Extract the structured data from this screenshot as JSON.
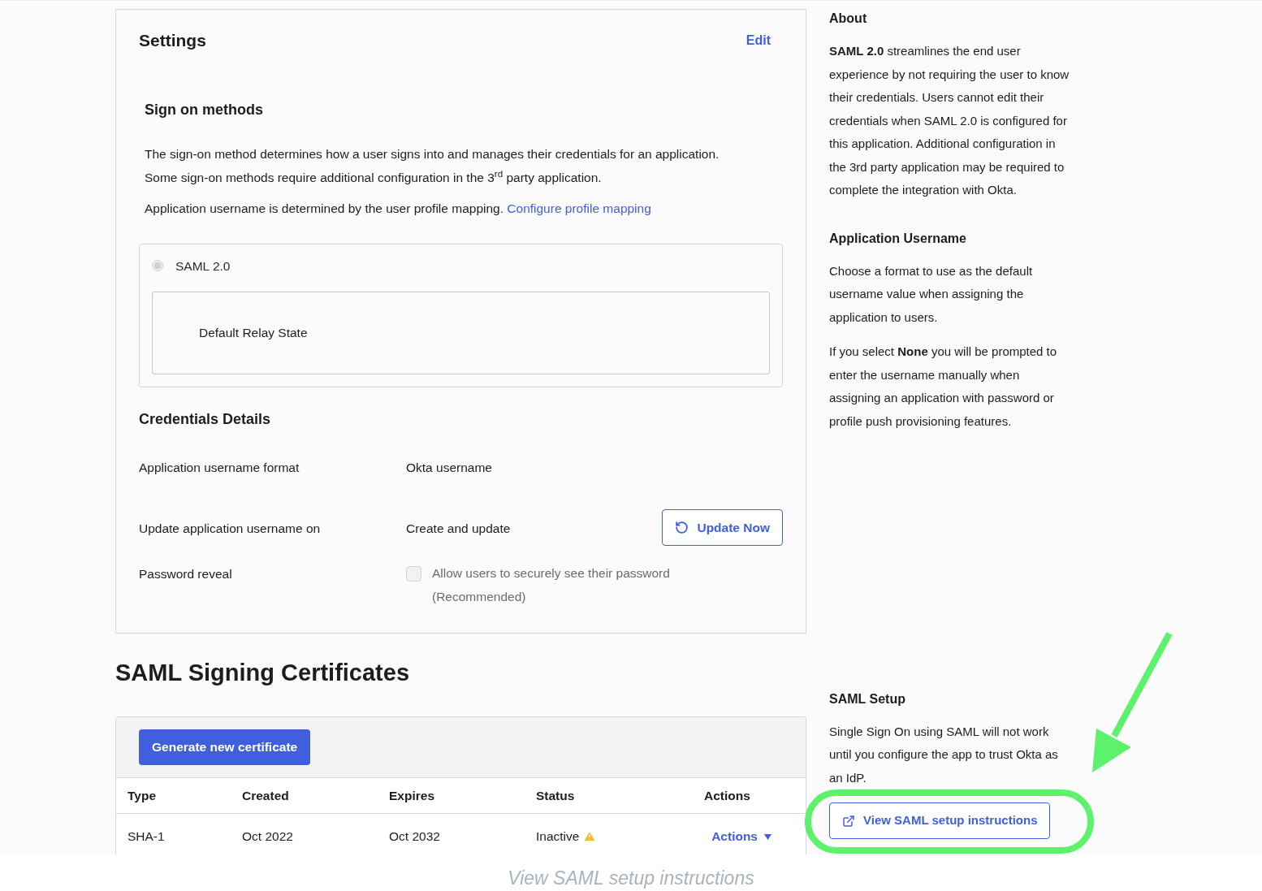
{
  "settings": {
    "title": "Settings",
    "edit_link": "Edit",
    "sign_on": {
      "heading": "Sign on methods",
      "description": "The sign-on method determines how a user signs into and manages their credentials for an application. Some sign-on methods require additional configuration in the 3$^{rd}$ party application.",
      "mapping_text": "Application username is determined by the user profile mapping.",
      "mapping_link": "Configure profile mapping",
      "methods": [
        {
          "label": "SAML 2.0",
          "selected": true,
          "disabled": true
        }
      ],
      "relay_state_label": "Default Relay State"
    },
    "credentials": {
      "heading": "Credentials Details",
      "rows": [
        {
          "kind": "text",
          "label": "Application username format",
          "value": "Okta username"
        },
        {
          "kind": "button",
          "label": "Update application username on",
          "value": "Create and update",
          "button": "Update Now"
        },
        {
          "kind": "checkbox",
          "label": "Password reveal",
          "checkbox_label": "Allow users to securely see their password (Recommended)",
          "checked": false
        }
      ]
    }
  },
  "certificates": {
    "heading": "SAML Signing Certificates",
    "generate_button": "Generate new certificate",
    "columns": [
      "Type",
      "Created",
      "Expires",
      "Status",
      "Actions"
    ],
    "rows": [
      {
        "type": "SHA-1",
        "created": "Oct 2022",
        "expires": "Oct 2032",
        "status": "Inactive",
        "warning": true,
        "action": "Actions"
      }
    ]
  },
  "sidebar": {
    "sections": [
      {
        "heading": "About",
        "paragraphs": [
          "**SAML 2.0** streamlines the end user experience by not requiring the user to know their credentials. Users cannot edit their credentials when SAML 2.0 is configured for this application. Additional configuration in the 3rd party application may be required to complete the integration with Okta."
        ]
      },
      {
        "heading": "Application Username",
        "paragraphs": [
          "Choose a format to use as the default username value when assigning the application to users.",
          "If you select **None** you will be prompted to enter the username manually when assigning an application with password or profile push provisioning features."
        ]
      },
      {
        "heading": "SAML Setup",
        "paragraphs": [
          "Single Sign On using SAML will not work until you configure the app to trust Okta as an IdP."
        ],
        "button": "View SAML setup instructions"
      }
    ]
  },
  "caption": "View SAML setup instructions"
}
